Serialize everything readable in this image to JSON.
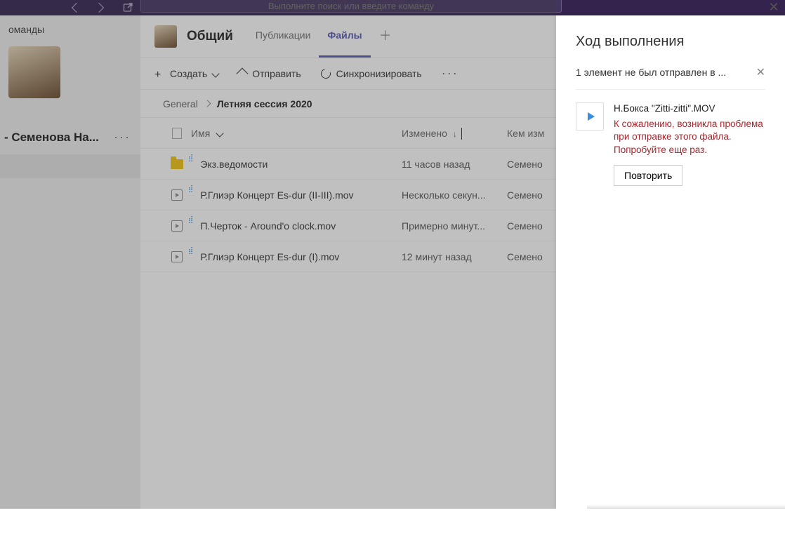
{
  "topbar": {
    "search_placeholder": "Выполните поиск или введите команду"
  },
  "sidebar": {
    "header": "оманды",
    "team_name": "- Семенова На..."
  },
  "channel": {
    "title": "Общий",
    "tabs": [
      {
        "label": "Публикации",
        "active": false
      },
      {
        "label": "Файлы",
        "active": true
      }
    ]
  },
  "toolbar": {
    "create": "Создать",
    "upload": "Отправить",
    "sync": "Синхронизировать"
  },
  "breadcrumb": {
    "root": "General",
    "current": "Летняя сессия 2020"
  },
  "columns": {
    "name": "Имя",
    "modified": "Изменено",
    "by": "Кем изм"
  },
  "files": [
    {
      "icon": "folder",
      "name": "Экз.ведомости",
      "modified": "11 часов назад",
      "by": "Семено"
    },
    {
      "icon": "video",
      "name": "Р.Глиэр Концерт Es-dur (II-III).mov",
      "modified": "Несколько секун...",
      "by": "Семено"
    },
    {
      "icon": "video",
      "name": "П.Черток - Around'o clock.mov",
      "modified": "Примерно минут...",
      "by": "Семено"
    },
    {
      "icon": "video",
      "name": "Р.Глиэр Концерт Es-dur (I).mov",
      "modified": "12 минут назад",
      "by": "Семено"
    }
  ],
  "panel": {
    "title": "Ход выполнения",
    "status": "1 элемент не был отправлен в ...",
    "item": {
      "name": "Н.Бокса \"Zitti-zitti\".MOV",
      "error": "К сожалению, возникла проблема при отправке этого файла. Попробуйте еще раз.",
      "retry": "Повторить"
    }
  }
}
